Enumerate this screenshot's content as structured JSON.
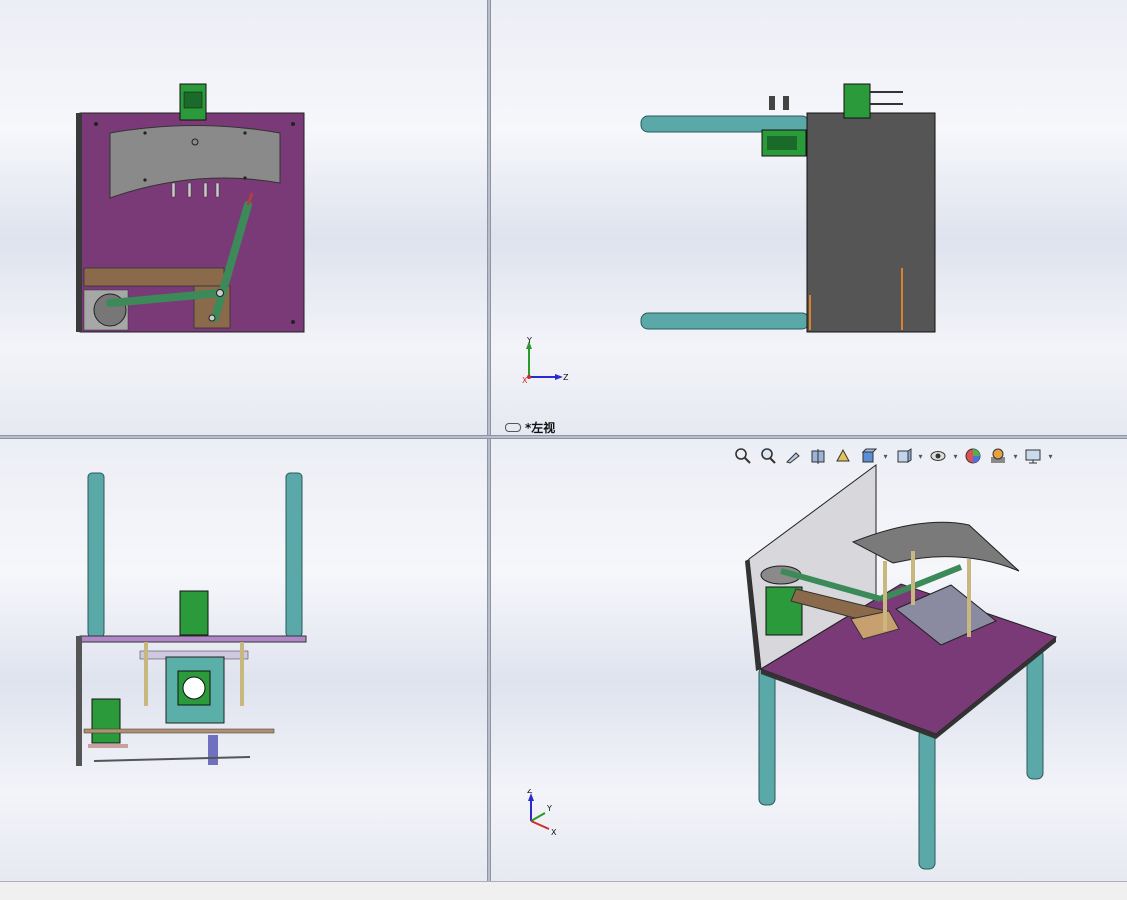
{
  "viewports": {
    "top_left": {
      "name": "front-view"
    },
    "top_right": {
      "name": "left-view",
      "label": "*左视"
    },
    "bottom_left": {
      "name": "top-view"
    },
    "bottom_right": {
      "name": "isometric-view"
    }
  },
  "triad_left": {
    "axis_up": "Y",
    "axis_right": "Z",
    "axis_origin": "X"
  },
  "triad_iso": {
    "axis_up": "Z",
    "axis_right": "Y",
    "axis_front": "X"
  },
  "heads_up_toolbar": {
    "icons": [
      "zoom-to-fit-icon",
      "zoom-to-area-icon",
      "previous-view-icon",
      "section-view-icon",
      "dynamic-annotation-icon",
      "view-orientation-icon",
      "display-style-icon",
      "hide-show-items-icon",
      "edit-appearance-icon",
      "apply-scene-icon",
      "view-settings-icon"
    ]
  },
  "colors": {
    "plate_purple": "#7a3a78",
    "plate_gray": "#6b6b6b",
    "leg_teal": "#5aa8a8",
    "motor_green": "#2a9a3a",
    "arm_green": "#3c8a5a",
    "bar_brown": "#8a6a4a"
  }
}
